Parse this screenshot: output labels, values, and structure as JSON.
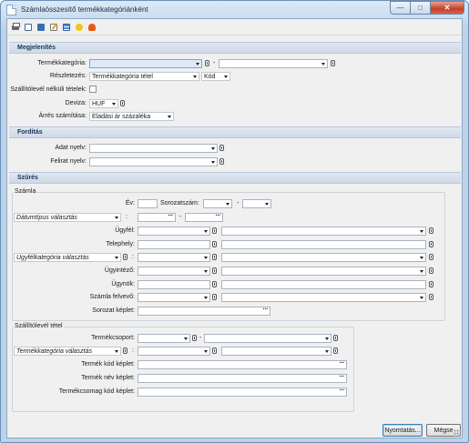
{
  "window": {
    "title": "Számlaösszesítő termékkategóriánként",
    "minimize": "—",
    "maximize": "□",
    "close": "✕"
  },
  "toolbar": [
    "printer-icon",
    "preview-icon",
    "export-icon",
    "edit-icon",
    "table-icon",
    "star-icon",
    "heart-icon"
  ],
  "sections": {
    "display": "Megjelenítés",
    "translation": "Fordítás",
    "filter": "Szűrés"
  },
  "display": {
    "product_category_label": "Termékkategória:",
    "range_sep": "-",
    "details_label": "Részletezés:",
    "details_value": "Termékkategória tétel",
    "code_value": "Kód",
    "no_delivery_label": "Szállítólevél nélküli tételek:",
    "currency_label": "Deviza:",
    "currency_value": "HUF",
    "margin_label": "Árrés számítása:",
    "margin_value": "Eladási ár százaléka"
  },
  "translation": {
    "data_lang_label": "Adat nyelv:",
    "label_lang_label": "Felirat nyelv:"
  },
  "invoice": {
    "group_title": "Számla",
    "year_label": "Év:",
    "serial_label": "Sorozatszám:",
    "range_sep": "-",
    "date_type_label": "Dátumtípus választás",
    "customer_label": "Ügyfél:",
    "site_label": "Telephely:",
    "customer_cat_label": "Ügyfélkategória választás",
    "admin_label": "Ügyintéző:",
    "agent_label": "Ügynök:",
    "recorder_label": "Számla felvevő:",
    "serial_formula_label": "Sorozat képlet:",
    "colon": ":"
  },
  "delivery": {
    "group_title": "Szállítólevél tétel",
    "product_group_label": "Termékcsoport:",
    "range_sep": "-",
    "product_cat_label": "Termékkategória választás",
    "colon": ":",
    "product_code_label": "Termék kód képlet:",
    "product_name_label": "Termék név képlet:",
    "package_code_label": "Termékcsomag kód képlet:"
  },
  "footer": {
    "print_button": "Nyomtatás...",
    "cancel_button": "Mégse"
  },
  "colors": {
    "accent": "#ddeaf8",
    "section_header": "#cfd9e6",
    "window_frame": "#bcd3ea"
  }
}
